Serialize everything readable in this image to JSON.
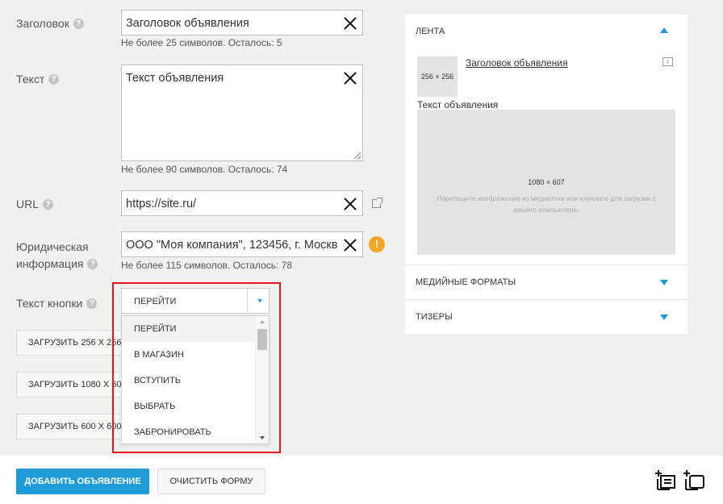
{
  "form": {
    "title_label": "Заголовок",
    "title_value": "Заголовок объявления",
    "title_hint": "Не более 25 символов. Осталось: 5",
    "text_label": "Текст",
    "text_value": "Текст объявления",
    "text_hint": "Не более 90 символов. Осталось: 74",
    "url_label": "URL",
    "url_value": "https://site.ru/",
    "legal_label_line1": "Юридическая",
    "legal_label_line2": "информация",
    "legal_value": "ООО \"Моя компания\", 123456, г. Москв",
    "legal_hint": "Не более 115 символов. Осталось: 78",
    "button_text_label": "Текст кнопки",
    "button_text_selected": "ПЕРЕЙТИ",
    "button_text_options": [
      "ПЕРЕЙТИ",
      "В МАГАЗИН",
      "ВСТУПИТЬ",
      "ВЫБРАТЬ",
      "ЗАБРОНИРОВАТЬ"
    ],
    "upload_256": "ЗАГРУЗИТЬ 256 X 256",
    "upload_1080": "ЗАГРУЗИТЬ 1080 X 607",
    "upload_600": "ЗАГРУЗИТЬ 600 X 600",
    "help_glyph": "?",
    "warning_glyph": "!"
  },
  "actions": {
    "add_label": "ДОБАВИТЬ ОБЪЯВЛЕНИЕ",
    "clear_label": "ОЧИСТИТЬ ФОРМУ"
  },
  "preview": {
    "feed_title": "ЛЕНТА",
    "thumb_size": "256 × 256",
    "ad_title": "Заголовок объявления",
    "info_glyph": "i",
    "ad_text": "Текст объявления",
    "image_size": "1080 × 607",
    "drop_hint": "Перетащите изображение из медиатеки или кликните для загрузки с вашего компьютера.",
    "media_formats_title": "МЕДИЙНЫЕ ФОРМАТЫ",
    "teasers_title": "ТИЗЕРЫ"
  },
  "colors": {
    "accent": "#1e9ad6",
    "highlight_border": "#e8141e",
    "warning": "#f5a623"
  },
  "icons": [
    "help-icon",
    "clear-icon",
    "external-link-icon",
    "warning-icon",
    "chevron-up-icon",
    "chevron-down-icon",
    "info-icon",
    "add-text-ad-icon",
    "add-image-ad-icon"
  ]
}
